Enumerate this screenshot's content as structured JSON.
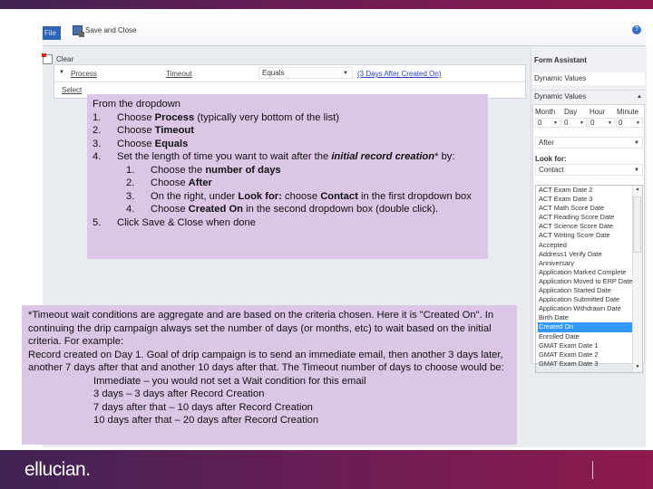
{
  "toolbar": {
    "file_label": "File",
    "save_close_label": "Save and Close",
    "help_icon": "?"
  },
  "criteria": {
    "clear_label": "Clear",
    "field1": "Process",
    "field2": "Timeout",
    "operator": "Equals",
    "value_link": "(3 Days After Created On)",
    "select_label": "Select"
  },
  "form_assistant": {
    "title": "Form Assistant",
    "dynamic_values_selected": "Dynamic Values",
    "dynamic_values_header": "Dynamic Values",
    "time_labels": [
      "Month",
      "Day",
      "Hour",
      "Minute"
    ],
    "time_values": [
      "0",
      "0",
      "0",
      "0"
    ],
    "relation": "After",
    "look_for_label": "Look for:",
    "entity": "Contact",
    "fields": [
      "ACT Exam Date 2",
      "ACT Exam Date 3",
      "ACT Math Score Date",
      "ACT Reading Score Date",
      "ACT Science Score Date",
      "ACT Writing Score Date",
      "Accepted",
      "Address1 Verify Date",
      "Anniversary",
      "Application Marked Complete",
      "Application Moved to ERP Date",
      "Application Started Date",
      "Application Submitted Date",
      "Application Withdrawn Date",
      "Birth Date",
      "Created On",
      "Enrolled Date",
      "GMAT Exam Date 1",
      "GMAT Exam Date 2",
      "GMAT Exam Date 3"
    ],
    "selected_field": "Created On"
  },
  "instructions": {
    "intro": "From the dropdown",
    "steps": [
      {
        "num": "1.",
        "pre": "Choose ",
        "bold": "Process",
        "post": " (typically very bottom of the list)"
      },
      {
        "num": "2.",
        "pre": "Choose ",
        "bold": "Timeout",
        "post": ""
      },
      {
        "num": "3.",
        "pre": "Choose ",
        "bold": "Equals",
        "post": ""
      },
      {
        "num": "4.",
        "pre": "Set the length of time you want to wait after the ",
        "bold": "initial record creation",
        "post": "* by:"
      }
    ],
    "substeps": [
      {
        "num": "1.",
        "pre": "Choose the ",
        "bold": "number of days",
        "post": ""
      },
      {
        "num": "2.",
        "pre": "Choose ",
        "bold": "After",
        "post": ""
      },
      {
        "num": "3.",
        "pre": "On the right, under ",
        "bold": "Look for:",
        "mid": " choose ",
        "bold2": "Contact",
        "post": " in the first dropdown box"
      },
      {
        "num": "4.",
        "pre": "Choose ",
        "bold": "Created On",
        "post": " in the second dropdown box (double click)."
      }
    ],
    "step5": {
      "num": "5.",
      "text": "Click Save & Close when done"
    }
  },
  "note": {
    "paragraph1": "*Timeout wait conditions are aggregate and are based on the criteria chosen. Here it is \"Created On\". In continuing the drip campaign always set the number of days (or months, etc) to wait based on the initial criteria. For example:",
    "paragraph2": "Record created on Day 1. Goal of drip campaign is to send an immediate email, then another 3 days later, another 7 days after that and another 10 days after that. The Timeout number of days to choose would be:",
    "examples": [
      "Immediate – you would not set a Wait condition for this email",
      "3 days – 3 days after Record Creation",
      "7 days after that – 10 days after Record Creation",
      "10 days after that – 20 days after Record Creation"
    ]
  },
  "footer": {
    "logo": "ellucian."
  },
  "colors": {
    "brand_start": "#3f2352",
    "brand_end": "#8f1a4d",
    "callout": "#dcc6e6",
    "selection": "#3399ff",
    "link": "#2a3fc0"
  }
}
